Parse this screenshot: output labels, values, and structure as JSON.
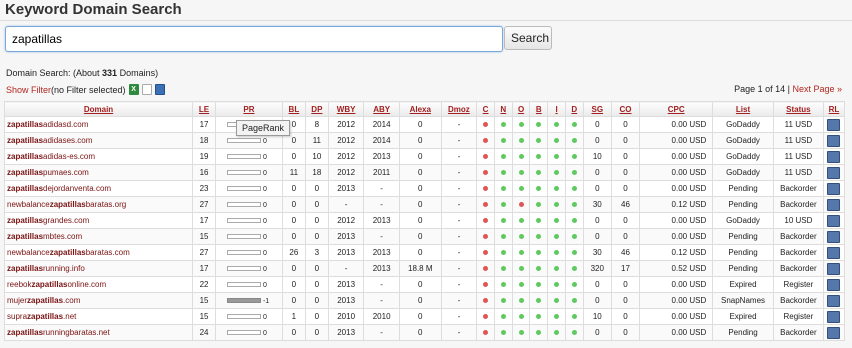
{
  "page": {
    "title": "Keyword Domain Search"
  },
  "search": {
    "value": "zapatillas",
    "button_label": "Search"
  },
  "summary": {
    "prefix": "Domain Search: (About ",
    "count": "331",
    "suffix": " Domains)"
  },
  "filter": {
    "link_label": "Show Filter",
    "status": " (no Filter selected)"
  },
  "pagination": {
    "page_text": "Page 1 of 14 | ",
    "next_label": "Next Page »"
  },
  "tooltip": {
    "text": "PageRank"
  },
  "columns": [
    "Domain",
    "LE",
    "PR",
    "BL",
    "DP",
    "WBY",
    "ABY",
    "Alexa",
    "Dmoz",
    "C",
    "N",
    "O",
    "B",
    "I",
    "D",
    "SG",
    "CO",
    "CPC",
    "List",
    "Status",
    "RL"
  ],
  "rows": [
    {
      "pre": "",
      "kw": "zapatillas",
      "post": "adidasd.com",
      "le": "17",
      "pr": "0",
      "prneg": false,
      "bl": "0",
      "dp": "8",
      "wby": "2012",
      "aby": "2014",
      "alexa": "0",
      "dmoz": "-",
      "cnobid": [
        "r",
        "g",
        "g",
        "g",
        "g",
        "g"
      ],
      "sg": "0",
      "co": "0",
      "cpc": "0.00 USD",
      "list": "GoDaddy",
      "status": "11 USD",
      "status_color": "green"
    },
    {
      "pre": "",
      "kw": "zapatillas",
      "post": "adidases.com",
      "le": "18",
      "pr": "0",
      "prneg": false,
      "bl": "0",
      "dp": "11",
      "wby": "2012",
      "aby": "2014",
      "alexa": "0",
      "dmoz": "-",
      "cnobid": [
        "r",
        "g",
        "g",
        "g",
        "g",
        "g"
      ],
      "sg": "0",
      "co": "0",
      "cpc": "0.00 USD",
      "list": "GoDaddy",
      "status": "11 USD",
      "status_color": "green"
    },
    {
      "pre": "",
      "kw": "zapatillas",
      "post": "adidas-es.com",
      "le": "19",
      "pr": "0",
      "prneg": false,
      "bl": "0",
      "dp": "10",
      "wby": "2012",
      "aby": "2013",
      "alexa": "0",
      "dmoz": "-",
      "cnobid": [
        "r",
        "g",
        "g",
        "g",
        "g",
        "g"
      ],
      "sg": "10",
      "co": "0",
      "cpc": "0.00 USD",
      "list": "GoDaddy",
      "status": "11 USD",
      "status_color": "green"
    },
    {
      "pre": "",
      "kw": "zapatillas",
      "post": "pumaes.com",
      "le": "16",
      "pr": "0",
      "prneg": false,
      "bl": "11",
      "dp": "18",
      "wby": "2012",
      "aby": "2011",
      "alexa": "0",
      "dmoz": "-",
      "cnobid": [
        "r",
        "g",
        "g",
        "g",
        "g",
        "g"
      ],
      "sg": "0",
      "co": "0",
      "cpc": "0.00 USD",
      "list": "GoDaddy",
      "status": "11 USD",
      "status_color": "green"
    },
    {
      "pre": "",
      "kw": "zapatillas",
      "post": "dejordanventa.com",
      "le": "23",
      "pr": "0",
      "prneg": false,
      "bl": "0",
      "dp": "0",
      "wby": "2013",
      "aby": "-",
      "alexa": "0",
      "dmoz": "-",
      "cnobid": [
        "r",
        "g",
        "g",
        "g",
        "g",
        "g"
      ],
      "sg": "0",
      "co": "0",
      "cpc": "0.00 USD",
      "list": "Pending",
      "status": "Backorder",
      "status_color": "red"
    },
    {
      "pre": "newbalance",
      "kw": "zapatillas",
      "post": "baratas.org",
      "le": "27",
      "pr": "0",
      "prneg": false,
      "bl": "0",
      "dp": "0",
      "wby": "-",
      "aby": "-",
      "alexa": "0",
      "dmoz": "-",
      "cnobid": [
        "r",
        "g",
        "r",
        "g",
        "g",
        "g"
      ],
      "sg": "30",
      "co": "46",
      "cpc": "0.12 USD",
      "list": "Pending",
      "status": "Backorder",
      "status_color": "red"
    },
    {
      "pre": "",
      "kw": "zapatillas",
      "post": "grandes.com",
      "le": "17",
      "pr": "0",
      "prneg": false,
      "bl": "0",
      "dp": "0",
      "wby": "2012",
      "aby": "2013",
      "alexa": "0",
      "dmoz": "-",
      "cnobid": [
        "r",
        "g",
        "g",
        "g",
        "g",
        "g"
      ],
      "sg": "0",
      "co": "0",
      "cpc": "0.00 USD",
      "list": "GoDaddy",
      "status": "10 USD",
      "status_color": "green"
    },
    {
      "pre": "",
      "kw": "zapatillas",
      "post": "mbtes.com",
      "le": "15",
      "pr": "0",
      "prneg": false,
      "bl": "0",
      "dp": "0",
      "wby": "2013",
      "aby": "-",
      "alexa": "0",
      "dmoz": "-",
      "cnobid": [
        "r",
        "g",
        "g",
        "g",
        "g",
        "g"
      ],
      "sg": "0",
      "co": "0",
      "cpc": "0.00 USD",
      "list": "Pending",
      "status": "Backorder",
      "status_color": "red"
    },
    {
      "pre": "newbalance",
      "kw": "zapatillas",
      "post": "baratas.com",
      "le": "27",
      "pr": "0",
      "prneg": false,
      "bl": "26",
      "dp": "3",
      "wby": "2013",
      "aby": "2013",
      "alexa": "0",
      "dmoz": "-",
      "cnobid": [
        "r",
        "g",
        "g",
        "g",
        "g",
        "g"
      ],
      "sg": "30",
      "co": "46",
      "cpc": "0.12 USD",
      "list": "Pending",
      "status": "Backorder",
      "status_color": "red"
    },
    {
      "pre": "",
      "kw": "zapatillas",
      "post": "running.info",
      "le": "17",
      "pr": "0",
      "prneg": false,
      "bl": "0",
      "dp": "0",
      "wby": "-",
      "aby": "2013",
      "alexa": "18.8 M",
      "dmoz": "-",
      "cnobid": [
        "r",
        "g",
        "g",
        "g",
        "g",
        "g"
      ],
      "sg": "320",
      "co": "17",
      "cpc": "0.52 USD",
      "list": "Pending",
      "status": "Backorder",
      "status_color": "red"
    },
    {
      "pre": "reebok",
      "kw": "zapatillas",
      "post": "online.com",
      "le": "22",
      "pr": "0",
      "prneg": false,
      "bl": "0",
      "dp": "0",
      "wby": "2013",
      "aby": "-",
      "alexa": "0",
      "dmoz": "-",
      "cnobid": [
        "r",
        "g",
        "g",
        "g",
        "g",
        "g"
      ],
      "sg": "0",
      "co": "0",
      "cpc": "0.00 USD",
      "list": "Expired",
      "status": "Register",
      "status_color": "black"
    },
    {
      "pre": "mujer",
      "kw": "zapatillas",
      "post": ".com",
      "le": "15",
      "pr": "-1",
      "prneg": true,
      "bl": "0",
      "dp": "0",
      "wby": "2013",
      "aby": "-",
      "alexa": "0",
      "dmoz": "-",
      "cnobid": [
        "r",
        "g",
        "g",
        "g",
        "g",
        "g"
      ],
      "sg": "0",
      "co": "0",
      "cpc": "0.00 USD",
      "list": "SnapNames",
      "status": "Backorder",
      "status_color": "red"
    },
    {
      "pre": "supra",
      "kw": "zapatillas",
      "post": ".net",
      "le": "15",
      "pr": "0",
      "prneg": false,
      "bl": "1",
      "dp": "0",
      "wby": "2010",
      "aby": "2010",
      "alexa": "0",
      "dmoz": "-",
      "cnobid": [
        "r",
        "g",
        "g",
        "g",
        "g",
        "g"
      ],
      "sg": "10",
      "co": "0",
      "cpc": "0.00 USD",
      "list": "Expired",
      "status": "Register",
      "status_color": "black"
    },
    {
      "pre": "",
      "kw": "zapatillas",
      "post": "runningbaratas.net",
      "le": "24",
      "pr": "0",
      "prneg": false,
      "bl": "0",
      "dp": "0",
      "wby": "2013",
      "aby": "-",
      "alexa": "0",
      "dmoz": "-",
      "cnobid": [
        "r",
        "g",
        "g",
        "g",
        "g",
        "g"
      ],
      "sg": "0",
      "co": "0",
      "cpc": "0.00 USD",
      "list": "Pending",
      "status": "Backorder",
      "status_color": "red"
    }
  ],
  "icons": {
    "export_excel": "excel-icon",
    "export_doc": "document-icon",
    "save": "save-icon",
    "reverse_lookup": "reverse-lookup-icon"
  }
}
